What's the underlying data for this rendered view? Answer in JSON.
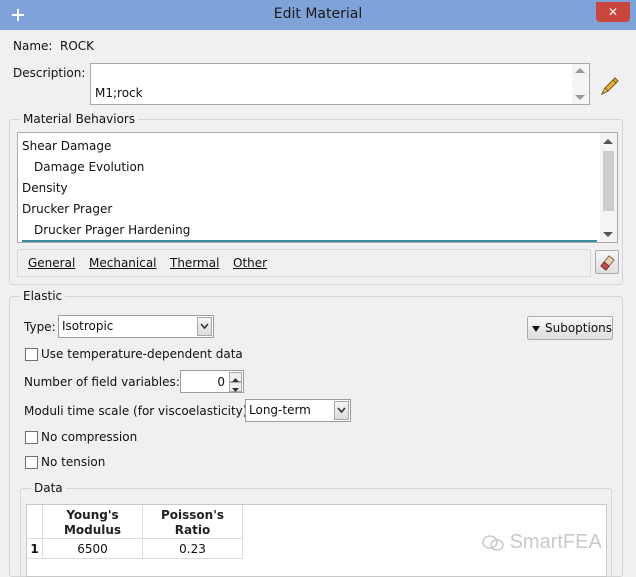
{
  "window": {
    "title": "Edit Material",
    "close_symbol": "✕"
  },
  "name": {
    "label": "Name:",
    "value": "ROCK"
  },
  "description": {
    "label": "Description:",
    "value": "M1;rock"
  },
  "behaviors": {
    "title": "Material Behaviors",
    "items": [
      {
        "label": "Shear Damage",
        "indent": false
      },
      {
        "label": "Damage Evolution",
        "indent": true
      },
      {
        "label": "Density",
        "indent": false
      },
      {
        "label": "Drucker Prager",
        "indent": false
      },
      {
        "label": "Drucker Prager Hardening",
        "indent": true
      }
    ]
  },
  "menu": {
    "items": [
      "General",
      "Mechanical",
      "Thermal",
      "Other"
    ]
  },
  "elastic": {
    "title": "Elastic",
    "type_label": "Type:",
    "type_value": "Isotropic",
    "suboptions_label": "Suboptions",
    "temp_dep_label": "Use temperature-dependent data",
    "field_vars_label": "Number of field variables:",
    "field_vars_value": "0",
    "moduli_label": "Moduli time scale (for viscoelasticity):",
    "moduli_value": "Long-term",
    "no_compression_label": "No compression",
    "no_tension_label": "No tension"
  },
  "data_table": {
    "title": "Data",
    "columns": [
      "Young's\nModulus",
      "Poisson's\nRatio"
    ],
    "rows": [
      {
        "index": "1",
        "values": [
          "6500",
          "0.23"
        ]
      }
    ]
  },
  "watermark": "SmartFEA",
  "colors": {
    "titlebar": "#7fa2d8",
    "close": "#c9463d",
    "accent_underline": "#3b8aa0"
  }
}
